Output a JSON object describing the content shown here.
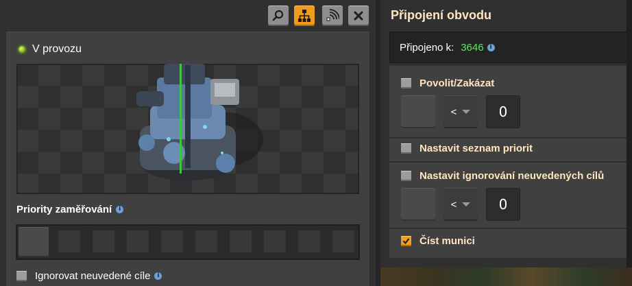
{
  "toolbar": {
    "buttons": [
      {
        "name": "search",
        "icon": "search-icon"
      },
      {
        "name": "network",
        "icon": "hierarchy-icon",
        "active": true
      },
      {
        "name": "circuit",
        "icon": "signal-icon"
      },
      {
        "name": "close",
        "icon": "close-icon"
      }
    ]
  },
  "left": {
    "status": "V provozu",
    "status_color": "#7fd11f",
    "priorities_title": "Priority zaměřování",
    "ignore_label": "Ignorovat neuvedené cíle"
  },
  "right": {
    "title": "Připojení obvodu",
    "connected_label": "Připojeno k:",
    "connected_value": "3646",
    "enable_disable": "Povolit/Zakázat",
    "condition1": {
      "comparator": "<",
      "constant": "0"
    },
    "set_priority": "Nastavit seznam priorit",
    "set_ignore": "Nastavit ignorování neuvedených cílů",
    "condition2": {
      "comparator": "<",
      "constant": "0"
    },
    "read_ammo": "Číst munici",
    "read_ammo_checked": true
  },
  "colors": {
    "accent": "#f29a1c",
    "title_text": "#ffe6c0",
    "connected_number": "#5ee65e"
  }
}
